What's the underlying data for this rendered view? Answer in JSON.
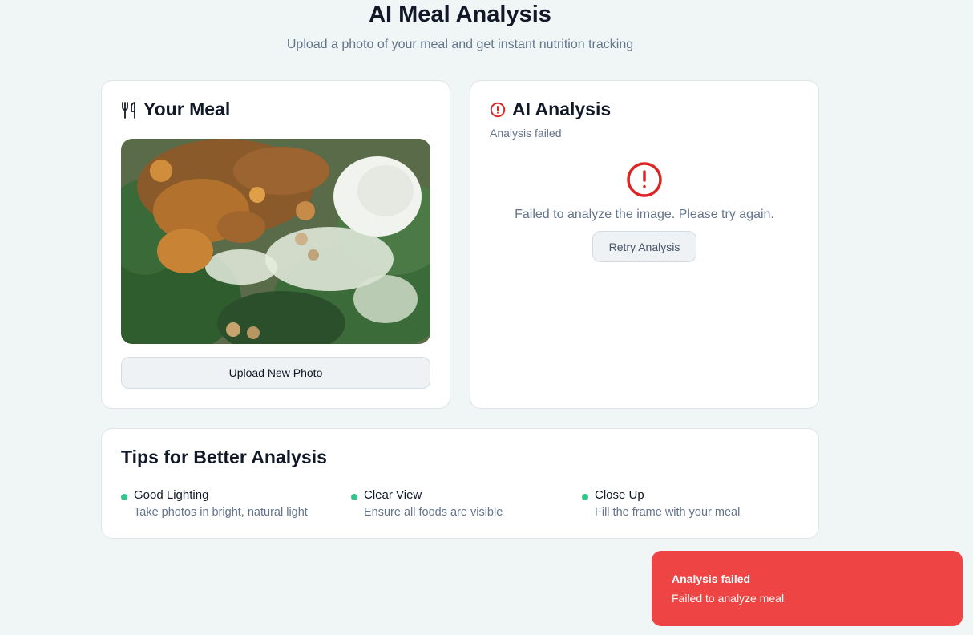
{
  "header": {
    "title": "AI Meal Analysis",
    "subtitle": "Upload a photo of your meal and get instant nutrition tracking"
  },
  "meal_card": {
    "title": "Your Meal",
    "icon": "utensils-icon",
    "upload_button": "Upload New Photo"
  },
  "analysis_card": {
    "title": "AI Analysis",
    "icon": "alert-circle-icon",
    "status": "Analysis failed",
    "error_message": "Failed to analyze the image. Please try again.",
    "retry_button": "Retry Analysis"
  },
  "tips": {
    "title": "Tips for Better Analysis",
    "items": [
      {
        "title": "Good Lighting",
        "description": "Take photos in bright, natural light"
      },
      {
        "title": "Clear View",
        "description": "Ensure all foods are visible"
      },
      {
        "title": "Close Up",
        "description": "Fill the frame with your meal"
      }
    ]
  },
  "toast": {
    "title": "Analysis failed",
    "description": "Failed to analyze meal"
  },
  "colors": {
    "background": "#f0f5f5",
    "error": "#dc2626",
    "toast": "#ef4444",
    "tip_dot": "#34c48c"
  }
}
